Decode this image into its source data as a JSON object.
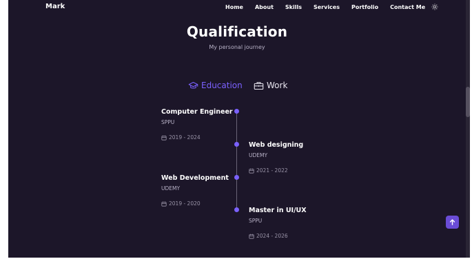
{
  "header": {
    "logo": "Mark",
    "nav": [
      "Home",
      "About",
      "Skills",
      "Services",
      "Portfolio",
      "Contact Me"
    ],
    "theme_toggle_icon": "sun-icon"
  },
  "section": {
    "title": "Qualification",
    "subtitle": "My personal journey"
  },
  "tabs": {
    "education": {
      "label": "Education",
      "icon": "graduation-cap-icon"
    },
    "work": {
      "label": "Work",
      "icon": "briefcase-icon"
    }
  },
  "timeline": [
    {
      "title": "Computer Engineer",
      "subtitle": "SPPU",
      "date": "2019 - 2024"
    },
    {
      "title": "Web designing",
      "subtitle": "UDEMY",
      "date": "2021 - 2022"
    },
    {
      "title": "Web Development",
      "subtitle": "UDEMY",
      "date": "2019 - 2020"
    },
    {
      "title": "Master in UI/UX",
      "subtitle": "SPPU",
      "date": "2024 - 2026"
    }
  ],
  "colors": {
    "background": "#1c1629",
    "accent": "#7b61ff",
    "text": "#ffffff",
    "muted": "#b9b3c8"
  },
  "scroll_top_icon": "arrow-up-icon"
}
